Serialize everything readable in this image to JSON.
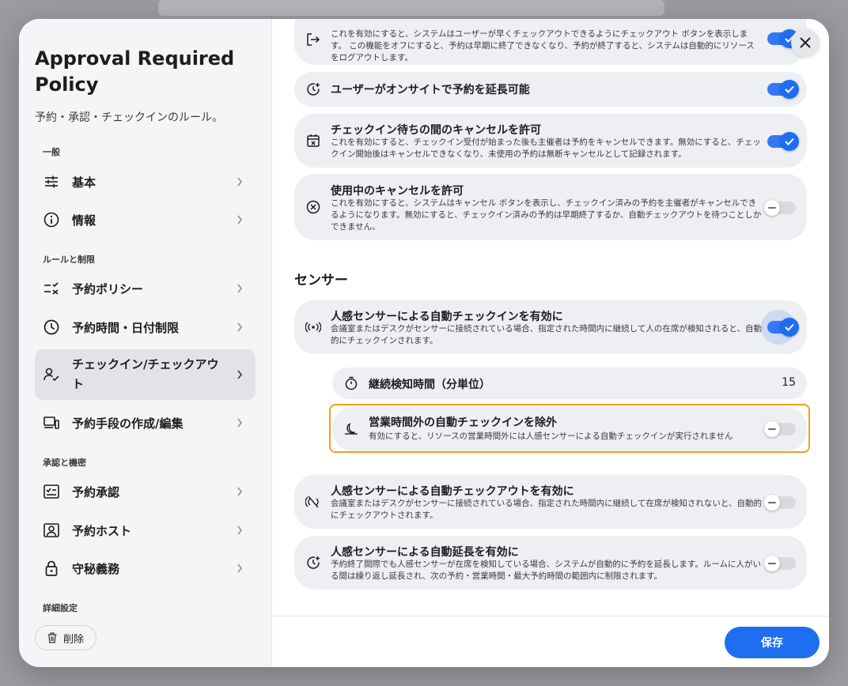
{
  "dialog": {
    "title": "Approval Required Policy",
    "subtitle": "予約・承認・チェックインのルール。"
  },
  "sidebar": {
    "sections": [
      "一般",
      "ルールと制限",
      "承認と機密",
      "詳細設定"
    ],
    "items": [
      {
        "label": "基本",
        "icon": "sliders-icon"
      },
      {
        "label": "情報",
        "icon": "info-icon"
      },
      {
        "label": "予約ポリシー",
        "icon": "checklist-icon"
      },
      {
        "label": "予約時間・日付制限",
        "icon": "clock-icon"
      },
      {
        "label": "チェックイン/チェックアウト",
        "icon": "user-check-icon"
      },
      {
        "label": "予約手段の作成/編集",
        "icon": "devices-icon"
      },
      {
        "label": "予約承認",
        "icon": "approval-icon"
      },
      {
        "label": "予約ホスト",
        "icon": "host-icon"
      },
      {
        "label": "守秘義務",
        "icon": "lock-icon"
      }
    ],
    "delete_label": "削除"
  },
  "cards": [
    {
      "title": "",
      "desc": "これを有効にすると、システムはユーザーが早くチェックアウトできるようにチェックアウト ボタンを表示します。 この機能をオフにすると、予約は早期に終了できなくなり、予約が終了すると、システムは自動的にリソースをログアウトします。",
      "on": true
    },
    {
      "title": "ユーザーがオンサイトで予約を延長可能",
      "desc": "",
      "on": true
    },
    {
      "title": "チェックイン待ちの間のキャンセルを許可",
      "desc": "これを有効にすると、チェックイン受付が始まった後も主催者は予約をキャンセルできます。無効にすると、チェックイン開始後はキャンセルできなくなり、未使用の予約は無断キャンセルとして記録されます。",
      "on": true
    },
    {
      "title": "使用中のキャンセルを許可",
      "desc": "これを有効にすると、システムはキャンセル ボタンを表示し、チェックイン済みの予約を主催者がキャンセルできるようになります。無効にすると、チェックイン済みの予約は早期終了するか、自動チェックアウトを待つことしかできません。",
      "on": false
    }
  ],
  "sensor": {
    "section_title": "センサー",
    "auto_checkin": {
      "title": "人感センサーによる自動チェックインを有効に",
      "desc": "会議室またはデスクがセンサーに接続されている場合、指定された時間内に継続して人の在席が検知されると、自動的にチェックインされます。",
      "on": true
    },
    "duration": {
      "label": "継続検知時間（分単位）",
      "value": "15"
    },
    "exclude": {
      "title": "営業時間外の自動チェックインを除外",
      "desc": "有効にすると、リソースの営業時間外には人感センサーによる自動チェックインが実行されません",
      "on": false
    },
    "auto_checkout": {
      "title": "人感センサーによる自動チェックアウトを有効に",
      "desc": "会議室またはデスクがセンサーに接続されている場合、指定された時間内に継続して在席が検知されないと、自動的にチェックアウトされます。",
      "on": false
    },
    "auto_extend": {
      "title": "人感センサーによる自動延長を有効に",
      "desc": "予約終了間際でも人感センサーが在席を検知している場合、システムが自動的に予約を延長します。ルームに人がいる間は繰り返し延長され、次の予約・営業時間・最大予約時間の範囲内に制限されます。",
      "on": false
    }
  },
  "footer": {
    "save_label": "保存"
  },
  "colors": {
    "accent": "#1d6ef0",
    "highlight": "#f0a11c"
  }
}
